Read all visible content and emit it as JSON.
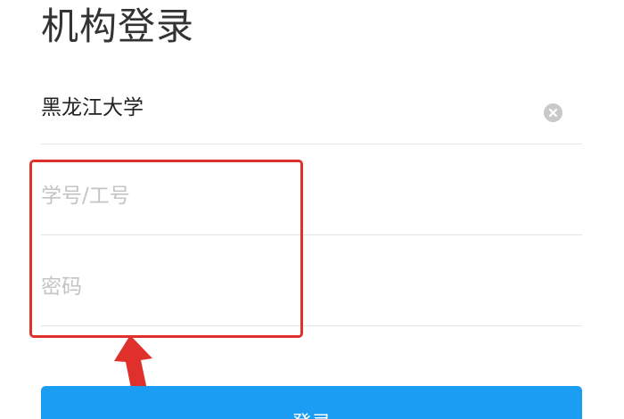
{
  "page": {
    "title": "机构登录"
  },
  "form": {
    "institution": {
      "value": "黑龙江大学",
      "clear_icon": "clear-circle-x"
    },
    "student_id": {
      "placeholder": "学号/工号",
      "value": ""
    },
    "password": {
      "placeholder": "密码",
      "value": ""
    },
    "login_label": "登录"
  },
  "annotation": {
    "highlight_color": "#e0302b"
  },
  "colors": {
    "primary_button": "#1a9df2",
    "title_text": "#333333",
    "placeholder": "#c4c4c4",
    "divider": "#e4e4e4"
  }
}
